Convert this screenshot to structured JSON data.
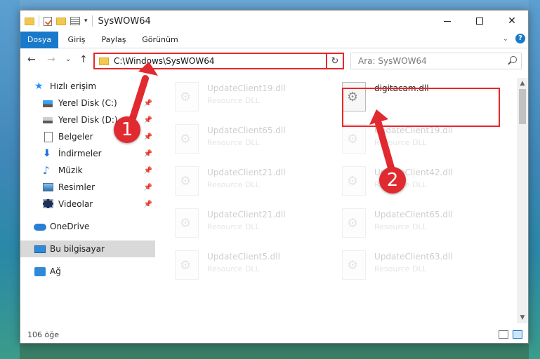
{
  "window": {
    "title": "SysWOW64",
    "qat_dropdown": "▾",
    "controls": {
      "minimize": "",
      "maximize": "",
      "close": "✕"
    }
  },
  "ribbon": {
    "tabs": [
      "Dosya",
      "Giriş",
      "Paylaş",
      "Görünüm"
    ],
    "active_tab": "Dosya",
    "collapse": "⌄",
    "help": "?"
  },
  "nav": {
    "back": "←",
    "forward": "→",
    "recent": "⌄",
    "up": "↑",
    "address": "C:\\Windows\\SysWOW64",
    "address_dropdown": "⌄",
    "refresh": "↻",
    "search_placeholder": "Ara: SysWOW64"
  },
  "sidebar": {
    "items": [
      {
        "label": "Hızlı erişim",
        "icon": "star-icon"
      },
      {
        "label": "Yerel Disk (C:)",
        "icon": "drive-icon",
        "pinned": true
      },
      {
        "label": "Yerel Disk (D:)",
        "icon": "drive-icon",
        "pinned": true
      },
      {
        "label": "Belgeler",
        "icon": "documents-icon",
        "pinned": true
      },
      {
        "label": "İndirmeler",
        "icon": "download-icon",
        "pinned": true
      },
      {
        "label": "Müzik",
        "icon": "music-icon",
        "pinned": true
      },
      {
        "label": "Resimler",
        "icon": "pictures-icon",
        "pinned": true
      },
      {
        "label": "Videolar",
        "icon": "videos-icon",
        "pinned": true
      },
      {
        "label": "OneDrive",
        "icon": "cloud-icon"
      },
      {
        "label": "Bu bilgisayar",
        "icon": "computer-icon",
        "selected": true
      },
      {
        "label": "Ağ",
        "icon": "network-icon"
      }
    ],
    "pin_glyph": "📌",
    "star_glyph": "★",
    "download_glyph": "⬇",
    "music_glyph": "♪"
  },
  "files": [
    {
      "name": "UpdateClient19.dll",
      "type": "Resource DLL",
      "faded": true
    },
    {
      "name": "digitacam.dll",
      "type": "",
      "faded": false
    },
    {
      "name": "UpdateClient65.dll",
      "type": "Resource DLL",
      "faded": true
    },
    {
      "name": "UpdateClient19.dll",
      "type": "Resource DLL",
      "faded": true
    },
    {
      "name": "UpdateClient21.dll",
      "type": "Resource DLL",
      "faded": true
    },
    {
      "name": "UpdateClient42.dll",
      "type": "Resource DLL",
      "faded": true
    },
    {
      "name": "UpdateClient21.dll",
      "type": "Resource DLL",
      "faded": true
    },
    {
      "name": "UpdateClient65.dll",
      "type": "Resource DLL",
      "faded": true
    },
    {
      "name": "UpdateClient5.dll",
      "type": "Resource DLL",
      "faded": true
    },
    {
      "name": "UpdateClient63.dll",
      "type": "Resource DLL",
      "faded": true
    }
  ],
  "status": {
    "count": "106 öğe"
  },
  "scroll": {
    "up": "▲",
    "down": "▼"
  },
  "callouts": [
    "1",
    "2"
  ],
  "colors": {
    "accent": "#1979ca",
    "callout_red": "#e12a2f",
    "highlight_border": "#e8272c"
  }
}
